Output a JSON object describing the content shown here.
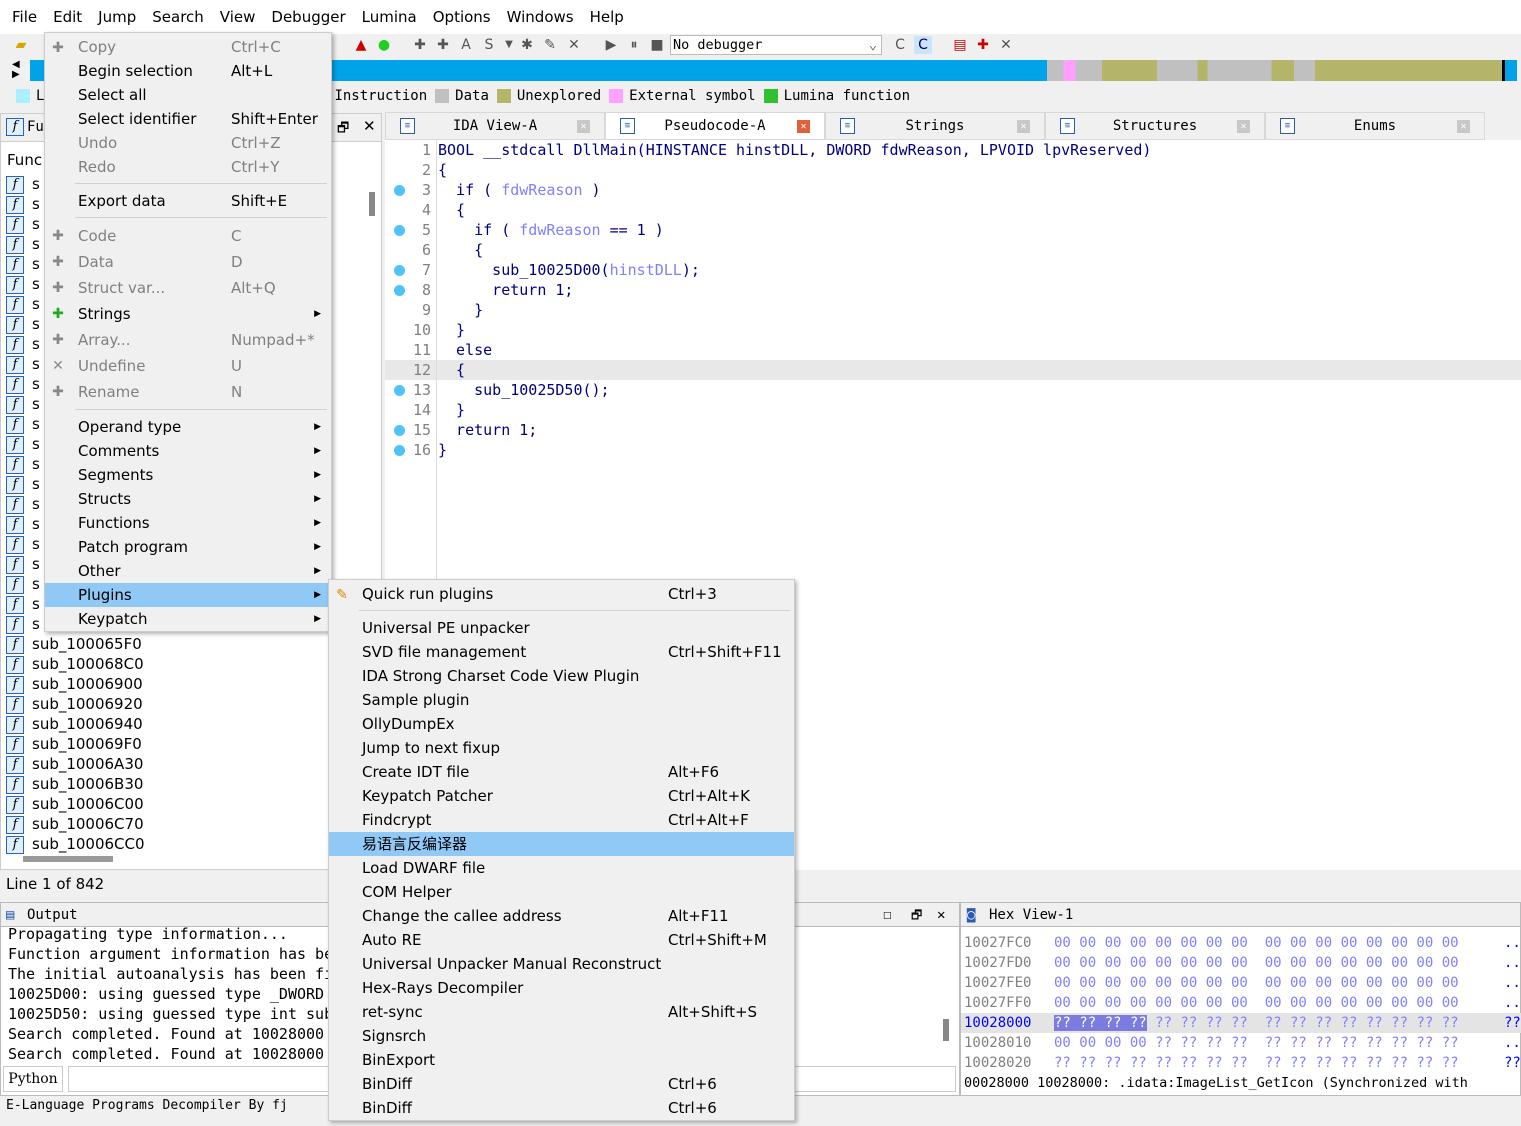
{
  "menubar": [
    "File",
    "Edit",
    "Jump",
    "Search",
    "View",
    "Debugger",
    "Lumina",
    "Options",
    "Windows",
    "Help"
  ],
  "toolbar": {
    "debugger_select": "No debugger"
  },
  "colors": {
    "nav_code": "#00a2e8",
    "instruction": "#b07050",
    "data": "#c0c0c0",
    "unexplored": "#b5b56a",
    "external": "#ffa0ff",
    "lumina": "#30c030",
    "library": "#aaf0ff",
    "menu_highlight": "#90c8f6"
  },
  "legend": [
    {
      "label": "L",
      "color": "#aaf0ff"
    },
    {
      "label": "Instruction",
      "color": "#b07050"
    },
    {
      "label": "Data",
      "color": "#c0c0c0"
    },
    {
      "label": "Unexplored",
      "color": "#b5b56a"
    },
    {
      "label": "External symbol",
      "color": "#ffa0ff"
    },
    {
      "label": "Lumina function",
      "color": "#30c030"
    }
  ],
  "tabs": [
    {
      "label": "IDA View-A",
      "icon": "document-icon"
    },
    {
      "label": "Pseudocode-A",
      "icon": "document-icon",
      "active": true
    },
    {
      "label": "Strings",
      "icon": "strings-icon"
    },
    {
      "label": "Structures",
      "icon": "structures-icon"
    },
    {
      "label": "Enums",
      "icon": "enums-icon"
    }
  ],
  "functions_panel": {
    "title": "Fu",
    "column": "Func",
    "visible_names": [
      "sub_100065F0",
      "sub_100068C0",
      "sub_10006900",
      "sub_10006920",
      "sub_10006940",
      "sub_100069F0",
      "sub_10006A30",
      "sub_10006B30",
      "sub_10006C00",
      "sub_10006C70",
      "sub_10006CC0"
    ],
    "hidden_prefix": "s",
    "status": "Line 1 of 842"
  },
  "code": [
    {
      "n": "1",
      "t": "BOOL __stdcall DllMain(HINSTANCE hinstDLL, DWORD fdwReason, LPVOID lpvReserved)"
    },
    {
      "n": "2",
      "t": "{"
    },
    {
      "n": "3",
      "t": "  if ( <v>fdwReason</v> )",
      "bp": true
    },
    {
      "n": "4",
      "t": "  {"
    },
    {
      "n": "5",
      "t": "    if ( <v>fdwReason</v> == 1 )",
      "bp": true
    },
    {
      "n": "6",
      "t": "    {"
    },
    {
      "n": "7",
      "t": "      sub_10025D00(<v>hinstDLL</v>);",
      "bp": true
    },
    {
      "n": "8",
      "t": "      return 1;",
      "bp": true
    },
    {
      "n": "9",
      "t": "    }"
    },
    {
      "n": "10",
      "t": "  }"
    },
    {
      "n": "11",
      "t": "  else"
    },
    {
      "n": "12",
      "t": "  {",
      "current": true
    },
    {
      "n": "13",
      "t": "    sub_10025D50();",
      "bp": true
    },
    {
      "n": "14",
      "t": "  }"
    },
    {
      "n": "15",
      "t": "  return 1;",
      "bp": true
    },
    {
      "n": "16",
      "t": "}",
      "bp": true
    }
  ],
  "output": {
    "title": "Output",
    "lines": [
      "Propagating type information...",
      "Function argument information has be",
      "The initial autoanalysis has been fi",
      "10025D00: using guessed type _DWORD ",
      "10025D50: using guessed type int sub",
      "Search completed. Found at 10028000 ",
      "Search completed. Found at 10028000 "
    ],
    "python_button": "Python",
    "status": "E-Language Programs Decompiler By fj"
  },
  "hex": {
    "title": "Hex View-1",
    "rows": [
      {
        "a": "10027FC0",
        "b": "00 00 00 00 00 00 00 00  00 00 00 00 00 00 00 00",
        "c": ".."
      },
      {
        "a": "10027FD0",
        "b": "00 00 00 00 00 00 00 00  00 00 00 00 00 00 00 00",
        "c": ".."
      },
      {
        "a": "10027FE0",
        "b": "00 00 00 00 00 00 00 00  00 00 00 00 00 00 00 00",
        "c": ".."
      },
      {
        "a": "10027FF0",
        "b": "00 00 00 00 00 00 00 00  00 00 00 00 00 00 00 00",
        "c": ".."
      },
      {
        "a": "10028000",
        "b": "?? ?? ?? ?? ?? ?? ?? ??  ?? ?? ?? ?? ?? ?? ?? ??",
        "c": "??",
        "current": true,
        "selected": "?? ?? ?? ??"
      },
      {
        "a": "10028010",
        "b": "00 00 00 00 ?? ?? ?? ??  ?? ?? ?? ?? ?? ?? ?? ??",
        "c": ".."
      },
      {
        "a": "10028020",
        "b": "?? ?? ?? ?? ?? ?? ?? ??  ?? ?? ?? ?? ?? ?? ?? ??",
        "c": "??"
      }
    ],
    "status": "00028000 10028000: .idata:ImageList_GetIcon (Synchronized with"
  },
  "edit_menu": [
    {
      "label": "Copy",
      "shortcut": "Ctrl+C",
      "disabled": true,
      "icon": "copy-icon"
    },
    {
      "label": "Begin selection",
      "shortcut": "Alt+L"
    },
    {
      "label": "Select all",
      "shortcut": ""
    },
    {
      "label": "Select identifier",
      "shortcut": "Shift+Enter"
    },
    {
      "label": "Undo",
      "shortcut": "Ctrl+Z",
      "disabled": true
    },
    {
      "label": "Redo",
      "shortcut": "Ctrl+Y",
      "disabled": true
    },
    {
      "sep": true
    },
    {
      "label": "Export data",
      "shortcut": "Shift+E"
    },
    {
      "sep": true
    },
    {
      "label": "Code",
      "shortcut": "C",
      "disabled": true,
      "tall": true,
      "icon": "code-icon"
    },
    {
      "label": "Data",
      "shortcut": "D",
      "disabled": true,
      "tall": true,
      "icon": "data-icon"
    },
    {
      "label": "Struct var...",
      "shortcut": "Alt+Q",
      "disabled": true,
      "tall": true,
      "icon": "struct-var-icon"
    },
    {
      "label": "Strings",
      "shortcut": "",
      "submenu": true,
      "tall": true,
      "icon": "strings-icon"
    },
    {
      "label": "Array...",
      "shortcut": "Numpad+*",
      "disabled": true,
      "tall": true,
      "icon": "array-icon"
    },
    {
      "label": "Undefine",
      "shortcut": "U",
      "disabled": true,
      "tall": true,
      "icon": "undefine-icon"
    },
    {
      "label": "Rename",
      "shortcut": "N",
      "disabled": true,
      "tall": true,
      "icon": "rename-icon"
    },
    {
      "sep": true
    },
    {
      "label": "Operand type",
      "submenu": true
    },
    {
      "label": "Comments",
      "submenu": true
    },
    {
      "label": "Segments",
      "submenu": true
    },
    {
      "label": "Structs",
      "submenu": true
    },
    {
      "label": "Functions",
      "submenu": true
    },
    {
      "label": "Patch program",
      "submenu": true
    },
    {
      "label": "Other",
      "submenu": true
    },
    {
      "label": "Plugins",
      "submenu": true,
      "highlight": true
    },
    {
      "label": "Keypatch",
      "submenu": true
    }
  ],
  "plugins_menu": [
    {
      "label": "Quick run plugins",
      "shortcut": "Ctrl+3",
      "icon": "quick-run-icon"
    },
    {
      "sep": true
    },
    {
      "label": "Universal PE unpacker",
      "shortcut": ""
    },
    {
      "label": "SVD file management",
      "shortcut": "Ctrl+Shift+F11"
    },
    {
      "label": "IDA Strong Charset Code View Plugin",
      "shortcut": ""
    },
    {
      "label": "Sample plugin",
      "shortcut": ""
    },
    {
      "label": "OllyDumpEx",
      "shortcut": ""
    },
    {
      "label": "Jump to next fixup",
      "shortcut": ""
    },
    {
      "label": "Create IDT file",
      "shortcut": "Alt+F6"
    },
    {
      "label": "Keypatch Patcher",
      "shortcut": "Ctrl+Alt+K"
    },
    {
      "label": "Findcrypt",
      "shortcut": "Ctrl+Alt+F"
    },
    {
      "label": "易语言反编译器",
      "shortcut": "",
      "highlight": true
    },
    {
      "label": "Load DWARF file",
      "shortcut": ""
    },
    {
      "label": "COM Helper",
      "shortcut": ""
    },
    {
      "label": "Change the callee address",
      "shortcut": "Alt+F11"
    },
    {
      "label": "Auto RE",
      "shortcut": "Ctrl+Shift+M"
    },
    {
      "label": "Universal Unpacker Manual Reconstruct",
      "shortcut": ""
    },
    {
      "label": "Hex-Rays Decompiler",
      "shortcut": ""
    },
    {
      "label": "ret-sync",
      "shortcut": "Alt+Shift+S"
    },
    {
      "label": "Signsrch",
      "shortcut": ""
    },
    {
      "label": "BinExport",
      "shortcut": ""
    },
    {
      "label": "BinDiff",
      "shortcut": "Ctrl+6"
    },
    {
      "label": "BinDiff",
      "shortcut": "Ctrl+6"
    }
  ]
}
